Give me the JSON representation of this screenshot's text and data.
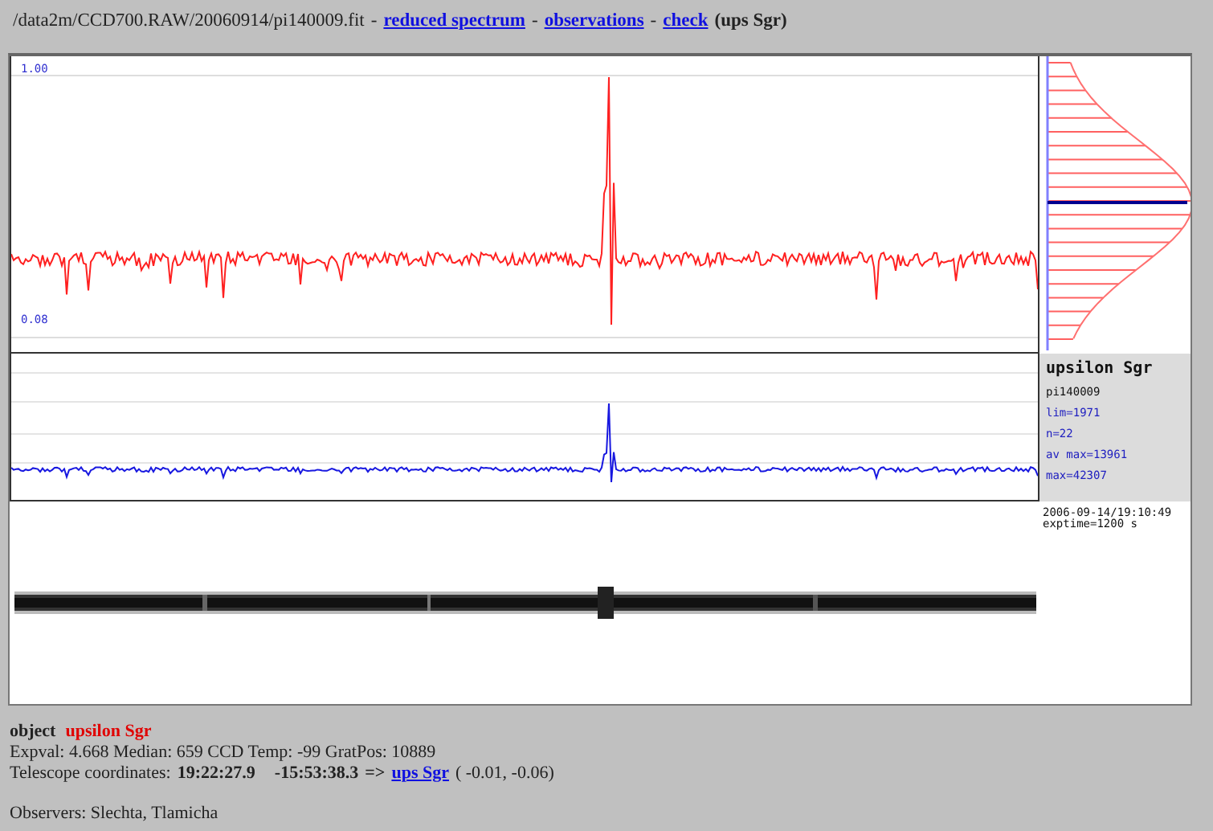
{
  "header": {
    "path": "/data2m/CCD700.RAW/20060914/pi140009.fit",
    "separator": "-",
    "links": [
      "reduced spectrum",
      "observations",
      "check"
    ],
    "suffix": "(ups Sgr)"
  },
  "spectrum_plot": {
    "top_label": "1.00",
    "bottom_label": "0.08"
  },
  "info": {
    "title": "upsilon Sgr",
    "lines": [
      {
        "text": "pi140009",
        "kind": "plain"
      },
      {
        "text": "lim=1971",
        "kind": "param"
      },
      {
        "text": "n=22",
        "kind": "param"
      },
      {
        "text": "av max=13961",
        "kind": "param"
      },
      {
        "text": "max=42307",
        "kind": "param"
      }
    ]
  },
  "timestamp": [
    "2006-09-14/19:10:49",
    "exptime=1200 s"
  ],
  "object": {
    "label": "object",
    "name": "upsilon Sgr"
  },
  "stats": "Expval: 4.668 Median: 659 CCD Temp: -99 GratPos: 10889",
  "telescope": {
    "label": "Telescope coordinates:",
    "ra": "19:22:27.9",
    "dec": "-15:53:38.3",
    "arrow": "=>",
    "link": "ups Sgr",
    "offset": "( -0.01, -0.06)"
  },
  "observers": "Observers: Slechta, Tlamicha"
}
